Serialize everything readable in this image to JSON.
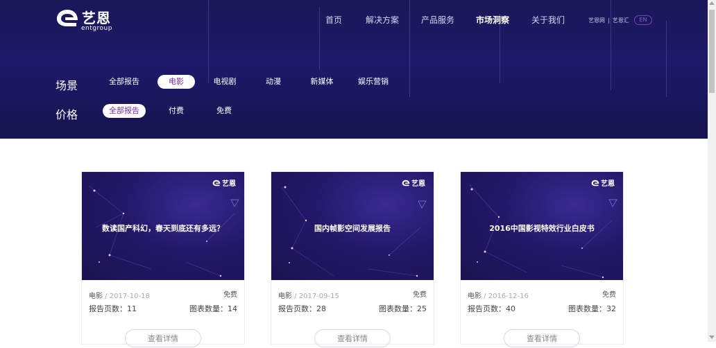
{
  "brand": {
    "name_cn": "艺恩",
    "name_en": "entgroup"
  },
  "nav": {
    "items": [
      {
        "label": "首页",
        "active": false
      },
      {
        "label": "解决方案",
        "active": false
      },
      {
        "label": "产品服务",
        "active": false
      },
      {
        "label": "市场洞察",
        "active": true
      },
      {
        "label": "关于我们",
        "active": false
      }
    ],
    "sub_links": [
      "艺恩网",
      "艺恩汇"
    ],
    "sub_sep": "|",
    "lang": "EN"
  },
  "filters": {
    "scene": {
      "label": "场景",
      "options": [
        "全部报告",
        "电影",
        "电视剧",
        "动漫",
        "新媒体",
        "娱乐营销"
      ],
      "selected": "电影"
    },
    "price": {
      "label": "价格",
      "options": [
        "全部报告",
        "付费",
        "免费"
      ],
      "selected": "全部报告"
    }
  },
  "cards": [
    {
      "title": "数读国产科幻，春天到底还有多远？",
      "category": "电影",
      "date": "/ 2017-10-18",
      "price": "免费",
      "pages_label": "报告页数：11",
      "charts_label": "图表数量：14",
      "button": "查看详情"
    },
    {
      "title": "国内帧影空间发展报告",
      "category": "电影",
      "date": "/ 2017-09-15",
      "price": "免费",
      "pages_label": "报告页数：28",
      "charts_label": "图表数量：25",
      "button": "查看详情"
    },
    {
      "title": "2016中国影视特效行业白皮书",
      "category": "电影",
      "date": "/ 2016-12-16",
      "price": "免费",
      "pages_label": "报告页数：40",
      "charts_label": "图表数量：32",
      "button": "查看详情"
    }
  ],
  "colors": {
    "hero_bg": "#1b1860",
    "accent": "#7a2bb5",
    "selected_chip_bg": "#ffffff"
  }
}
